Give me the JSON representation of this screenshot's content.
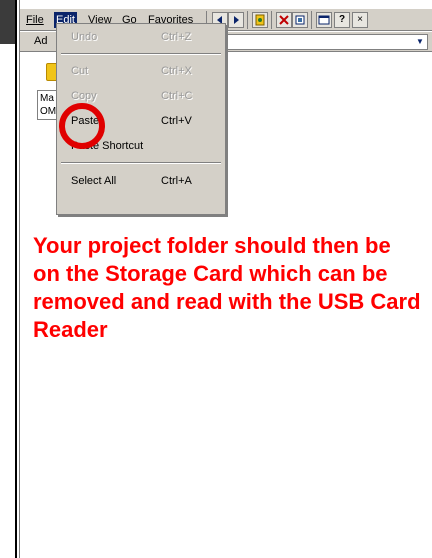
{
  "menubar": {
    "items": [
      {
        "label": "File"
      },
      {
        "label": "Edit"
      },
      {
        "label": "View"
      },
      {
        "label": "Go"
      },
      {
        "label": "Favorites"
      }
    ],
    "toolbar": {
      "icons": [
        "back-icon",
        "forward-icon",
        "favorites-icon",
        "delete-icon",
        "properties-icon",
        "view-icon",
        "help-icon",
        "close-icon"
      ],
      "help_label": "?",
      "close_label": "×"
    }
  },
  "address": {
    "label": "Ad"
  },
  "files": {
    "item_line1": "Ma",
    "item_line2": "OM"
  },
  "edit_menu": {
    "items": [
      {
        "label": "Undo",
        "shortcut": "Ctrl+Z",
        "enabled": false
      },
      {
        "label": "Cut",
        "shortcut": "Ctrl+X",
        "enabled": false
      },
      {
        "label": "Copy",
        "shortcut": "Ctrl+C",
        "enabled": false
      },
      {
        "label": "Paste",
        "shortcut": "Ctrl+V",
        "enabled": true
      },
      {
        "label": "Paste Shortcut",
        "shortcut": "",
        "enabled": true
      },
      {
        "label": "Select All",
        "shortcut": "Ctrl+A",
        "enabled": true
      }
    ]
  },
  "instruction": {
    "text": "Your project folder should then be on the Storage Card which can be removed and read with the USB Card Reader",
    "color": "#ff0000"
  },
  "colors": {
    "menu_bg": "#d4d0c8",
    "highlight": "#0a246a",
    "ring": "#e00000"
  }
}
